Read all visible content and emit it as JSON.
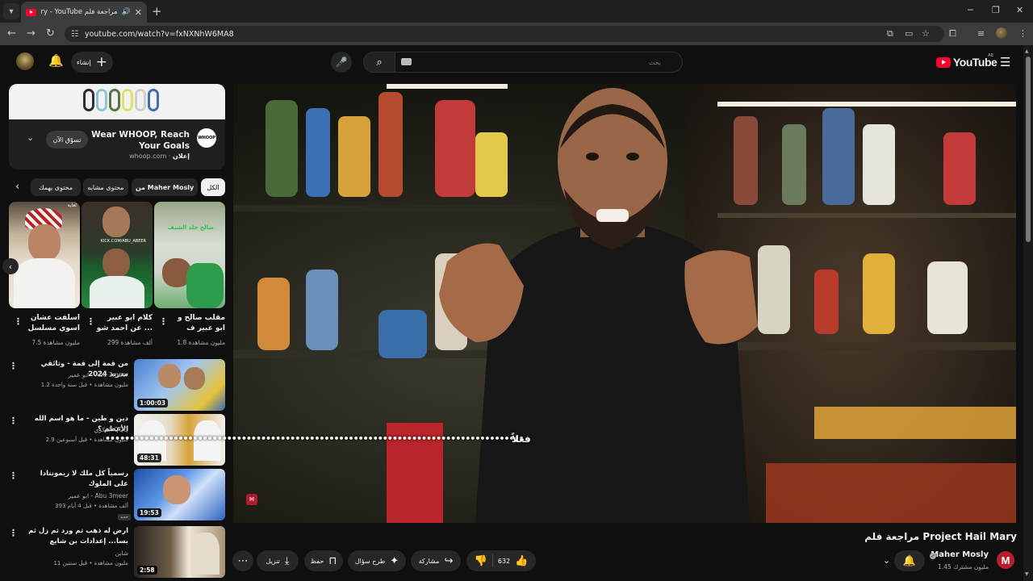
{
  "browser": {
    "tab_title": "مراجعة فلم Project Hail Mary - YouTube",
    "url": "youtube.com/watch?v=fxNXNhW6MA8"
  },
  "masthead": {
    "create_label": "إنشاء",
    "search_placeholder": "بحث",
    "logo_text": "YouTube",
    "country_code": "AE"
  },
  "ad": {
    "title": "Wear WHOOP, Reach Your Goals",
    "sponsored_label": "إعلان",
    "domain": "whoop.com",
    "meta_separator": " · ",
    "cta": "تسوّق الآن",
    "logo_text": "WHOOP"
  },
  "chips": [
    "الكل",
    "من Maher Mosly",
    "محتوى مشابه",
    "محتوى يهمك"
  ],
  "shorts": [
    {
      "title": "مقلب صالح و ابو عبير ف طاقم ...",
      "views": "1.8 مليون مشاهدة",
      "thumb_label": "صالح جلد الشيف"
    },
    {
      "title": "كلام ابو عبير عن احمد شو ...",
      "views": "299 ألف مشاهدة",
      "thumb_label": "KICK.COM/ABU_ABEER"
    },
    {
      "title": "اسلفت عشان اسوي مسلسل ...",
      "views": "7.5 مليون مشاهدة",
      "thumb_label": "لعابة"
    }
  ],
  "recommended": [
    {
      "title": "من قمة إلى قمة - وثائقي مدريد 2024",
      "channel": "ابو عمير - Abu 3meer",
      "meta": "1.2 مليون مشاهدة • قبل سنة واحدة",
      "duration": "1:00:03"
    },
    {
      "title": "دين و طين - ما هو اسم الله الأعظم ؟",
      "channel": "الفكري QQQ",
      "meta": "2.9 مليون مشاهدة • قبل أسبوعين",
      "duration": "48:31"
    },
    {
      "title": "رسمياً كل ملك لا ريمونتادا على الملوك",
      "channel": "ابو عمير - Abu 3meer",
      "meta": "393 ألف مشاهدة • قبل 4 أيام",
      "duration": "19:53",
      "badge": "جديد"
    },
    {
      "title": "ارض له ذهب ثم ورد ثم زل ثم بسا... إعدادات بن شايع",
      "channel": "شابن",
      "meta": "11 مليون مشاهدة • قبل سنتين",
      "duration": "2:58"
    }
  ],
  "player": {
    "caption": "••••••••••••••••••••••••••••••••••••••••••••••••••••••••••••••••••••••••••••••••••••••",
    "caption_word": "فعلاً"
  },
  "video": {
    "title": "مراجعة فلم Project Hail Mary",
    "channel": "Maher Mosly",
    "channel_initial": "M",
    "subscribers": "1.45 مليون مشترك",
    "like_count": "632",
    "share_label": "مشاركة",
    "ask_label": "طرح سؤال",
    "save_label": "حفظ",
    "download_label": "تنزيل"
  },
  "colors": {
    "brand_red": "#ff0033",
    "background": "#0f0f0f",
    "pill": "#272727"
  }
}
